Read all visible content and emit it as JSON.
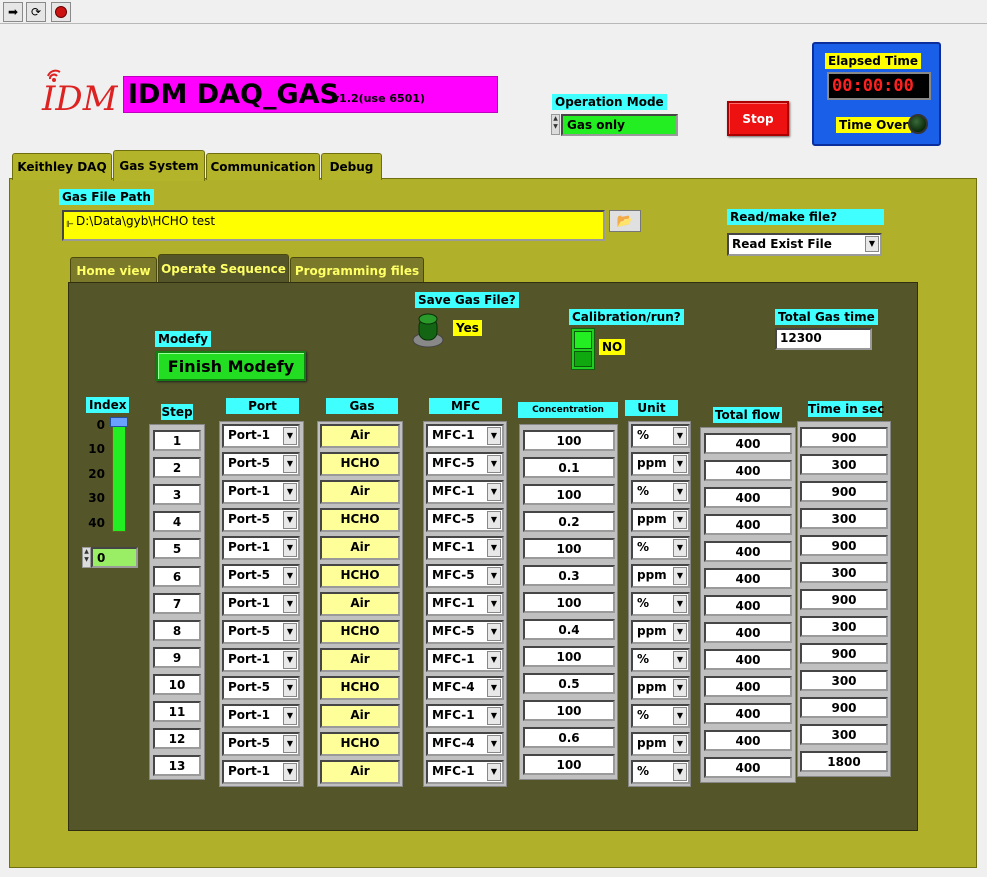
{
  "toolbar": {
    "run_icon": "run-arrow-icon",
    "run_continuous_icon": "run-continuous-icon",
    "abort_icon": "abort-icon"
  },
  "header": {
    "title": "IDM DAQ_GAS",
    "version": "v1.2(use 6501)",
    "logo_text": "IDM",
    "operation_mode_label": "Operation Mode",
    "operation_mode_value": "Gas only",
    "stop_label": "Stop",
    "elapsed_label": "Elapsed Time",
    "elapsed_value": "00:00:00",
    "time_over_label": "Time Over"
  },
  "main_tabs": [
    "Keithley DAQ",
    "Gas System",
    "Communication",
    "Debug"
  ],
  "gas_system": {
    "gas_file_path_label": "Gas File Path",
    "gas_file_path_value": "D:\\Data\\gyb\\HCHO test",
    "read_make_label": "Read/make file?",
    "read_make_value": "Read Exist File",
    "sub_tabs": [
      "Home view",
      "Operate Sequence",
      "Programming files"
    ],
    "save_gas_file_label": "Save Gas File?",
    "save_gas_file_value": "Yes",
    "calibration_label": "Calibration/run?",
    "calibration_value": "NO",
    "total_gas_time_label": "Total Gas time",
    "total_gas_time_value": "12300",
    "modefy_label": "Modefy",
    "modefy_button": "Finish Modefy",
    "index_label": "Index",
    "index_ticks": [
      "0",
      "10",
      "20",
      "30",
      "40"
    ],
    "index_value": "0",
    "col_headers": {
      "step": "Step",
      "port": "Port",
      "gas": "Gas",
      "mfc": "MFC",
      "concentration": "Concentration",
      "unit": "Unit",
      "total_flow": "Total flow",
      "time": "Time in sec"
    },
    "steps": [
      "1",
      "2",
      "3",
      "4",
      "5",
      "6",
      "7",
      "8",
      "9",
      "10",
      "11",
      "12",
      "13"
    ],
    "ports": [
      "Port-1",
      "Port-5",
      "Port-1",
      "Port-5",
      "Port-1",
      "Port-5",
      "Port-1",
      "Port-5",
      "Port-1",
      "Port-5",
      "Port-1",
      "Port-5",
      "Port-1"
    ],
    "gases": [
      "Air",
      "HCHO",
      "Air",
      "HCHO",
      "Air",
      "HCHO",
      "Air",
      "HCHO",
      "Air",
      "HCHO",
      "Air",
      "HCHO",
      "Air"
    ],
    "mfcs": [
      "MFC-1",
      "MFC-5",
      "MFC-1",
      "MFC-5",
      "MFC-1",
      "MFC-5",
      "MFC-1",
      "MFC-5",
      "MFC-1",
      "MFC-4",
      "MFC-1",
      "MFC-4",
      "MFC-1"
    ],
    "concentrations": [
      "100",
      "0.1",
      "100",
      "0.2",
      "100",
      "0.3",
      "100",
      "0.4",
      "100",
      "0.5",
      "100",
      "0.6",
      "100"
    ],
    "units": [
      "%",
      "ppm",
      "%",
      "ppm",
      "%",
      "ppm",
      "%",
      "ppm",
      "%",
      "ppm",
      "%",
      "ppm",
      "%"
    ],
    "total_flows": [
      "400",
      "400",
      "400",
      "400",
      "400",
      "400",
      "400",
      "400",
      "400",
      "400",
      "400",
      "400",
      "400"
    ],
    "times": [
      "900",
      "300",
      "900",
      "300",
      "900",
      "300",
      "900",
      "300",
      "900",
      "300",
      "900",
      "300",
      "1800"
    ]
  },
  "colors": {
    "panel": "#b0b02a",
    "inner_panel": "#55552a",
    "label_bg": "#40ffff",
    "title_bg": "#ff00ff",
    "stop": "#ee1111",
    "elapsed_bg": "#1a5fe8"
  }
}
